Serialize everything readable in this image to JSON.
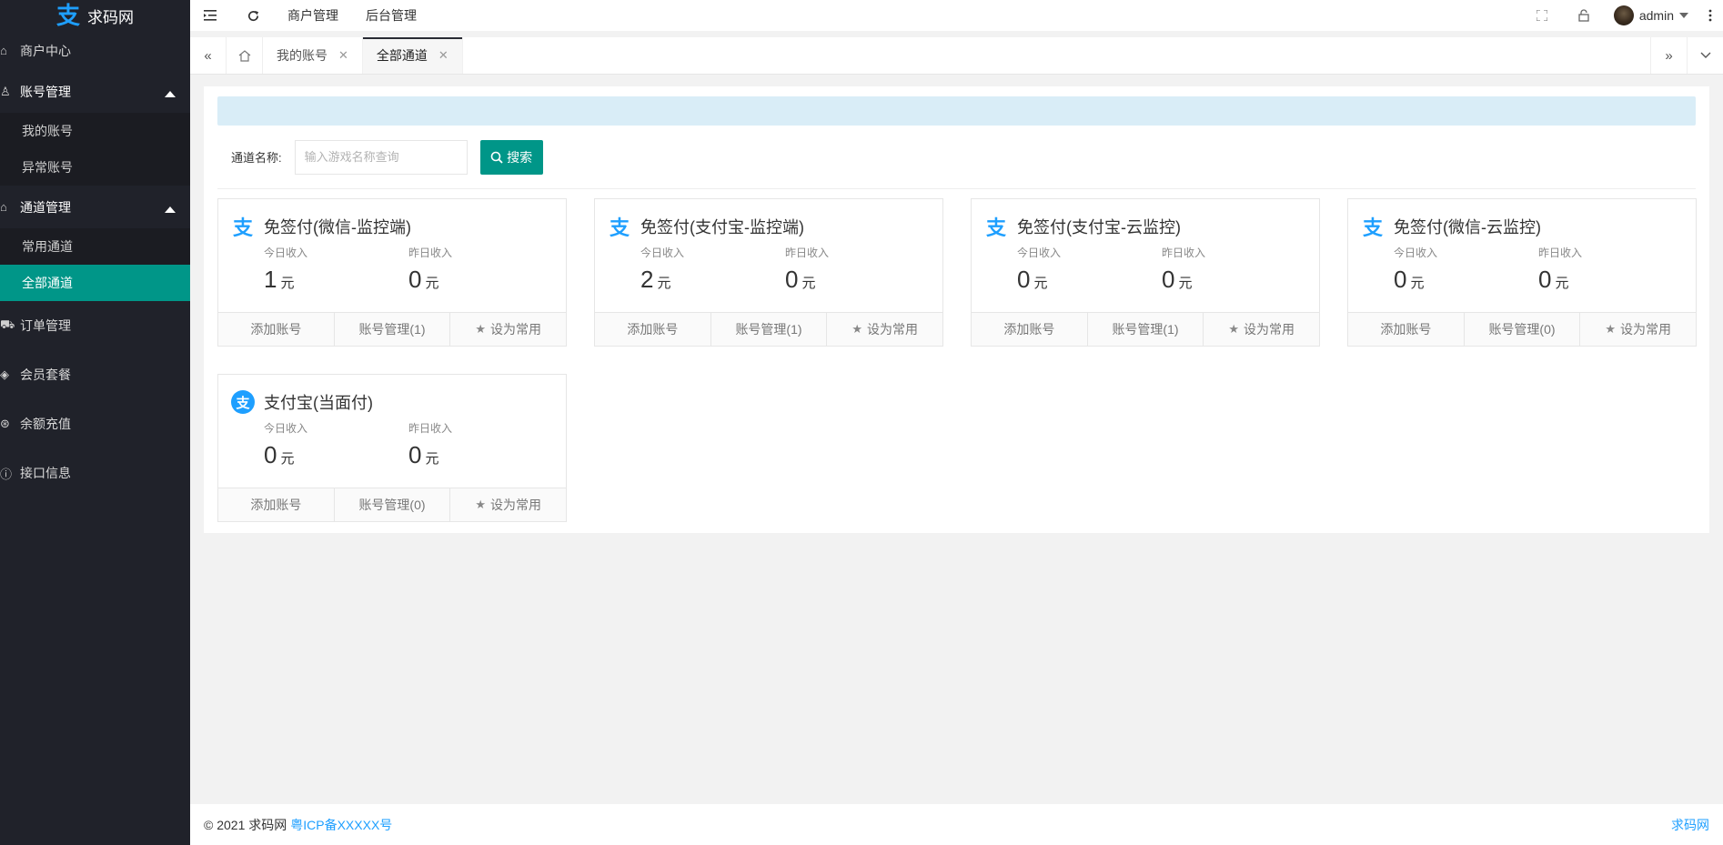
{
  "brand": {
    "logo_glyph": "支",
    "name": "求码网"
  },
  "sidebar": {
    "items": [
      {
        "icon": "house-icon",
        "glyph": "⌂",
        "label": "商户中心"
      },
      {
        "icon": "user-icon",
        "glyph": "♙",
        "label": "账号管理",
        "open": true,
        "children": [
          {
            "label": "我的账号"
          },
          {
            "label": "异常账号"
          }
        ]
      },
      {
        "icon": "home-icon",
        "glyph": "⌂",
        "label": "通道管理",
        "open": true,
        "children": [
          {
            "label": "常用通道"
          },
          {
            "label": "全部通道",
            "active": true
          }
        ]
      },
      {
        "icon": "cart-icon",
        "glyph": "⛟",
        "label": "订单管理"
      },
      {
        "icon": "diamond-icon",
        "glyph": "◈",
        "label": "会员套餐"
      },
      {
        "icon": "coin-icon",
        "glyph": "⊛",
        "label": "余额充值"
      },
      {
        "icon": "info-icon",
        "glyph": "ⓘ",
        "label": "接口信息"
      }
    ]
  },
  "header": {
    "links": [
      "商户管理",
      "后台管理"
    ],
    "user": "admin"
  },
  "tabs": {
    "items": [
      {
        "label": "我的账号",
        "active": false
      },
      {
        "label": "全部通道",
        "active": true
      }
    ]
  },
  "search": {
    "label": "通道名称:",
    "placeholder": "输入游戏名称查询",
    "button": "搜索"
  },
  "cards": [
    {
      "icon": "wechat-pay-icon",
      "title": "免签付(微信-监控端)",
      "today_label": "今日收入",
      "today": "1",
      "yesterday_label": "昨日收入",
      "yesterday": "0",
      "unit": "元",
      "add": "添加账号",
      "manage": "账号管理(1)",
      "fav": "设为常用"
    },
    {
      "icon": "alipay-pay-icon",
      "title": "免签付(支付宝-监控端)",
      "today_label": "今日收入",
      "today": "2",
      "yesterday_label": "昨日收入",
      "yesterday": "0",
      "unit": "元",
      "add": "添加账号",
      "manage": "账号管理(1)",
      "fav": "设为常用"
    },
    {
      "icon": "alipay-cloud-icon",
      "title": "免签付(支付宝-云监控)",
      "today_label": "今日收入",
      "today": "0",
      "yesterday_label": "昨日收入",
      "yesterday": "0",
      "unit": "元",
      "add": "添加账号",
      "manage": "账号管理(1)",
      "fav": "设为常用"
    },
    {
      "icon": "wechat-cloud-icon",
      "title": "免签付(微信-云监控)",
      "today_label": "今日收入",
      "today": "0",
      "yesterday_label": "昨日收入",
      "yesterday": "0",
      "unit": "元",
      "add": "添加账号",
      "manage": "账号管理(0)",
      "fav": "设为常用"
    },
    {
      "icon": "alipay-icon",
      "title": "支付宝(当面付)",
      "today_label": "今日收入",
      "today": "0",
      "yesterday_label": "昨日收入",
      "yesterday": "0",
      "unit": "元",
      "add": "添加账号",
      "manage": "账号管理(0)",
      "fav": "设为常用"
    }
  ],
  "footer": {
    "copyright": "© 2021 求码网",
    "icp": "粤ICP备XXXXX号",
    "right": "求码网"
  },
  "colors": {
    "sidebar_bg": "#20222a",
    "accent": "#009688",
    "link": "#1e9fff",
    "alert_bg": "#d9edf7"
  }
}
